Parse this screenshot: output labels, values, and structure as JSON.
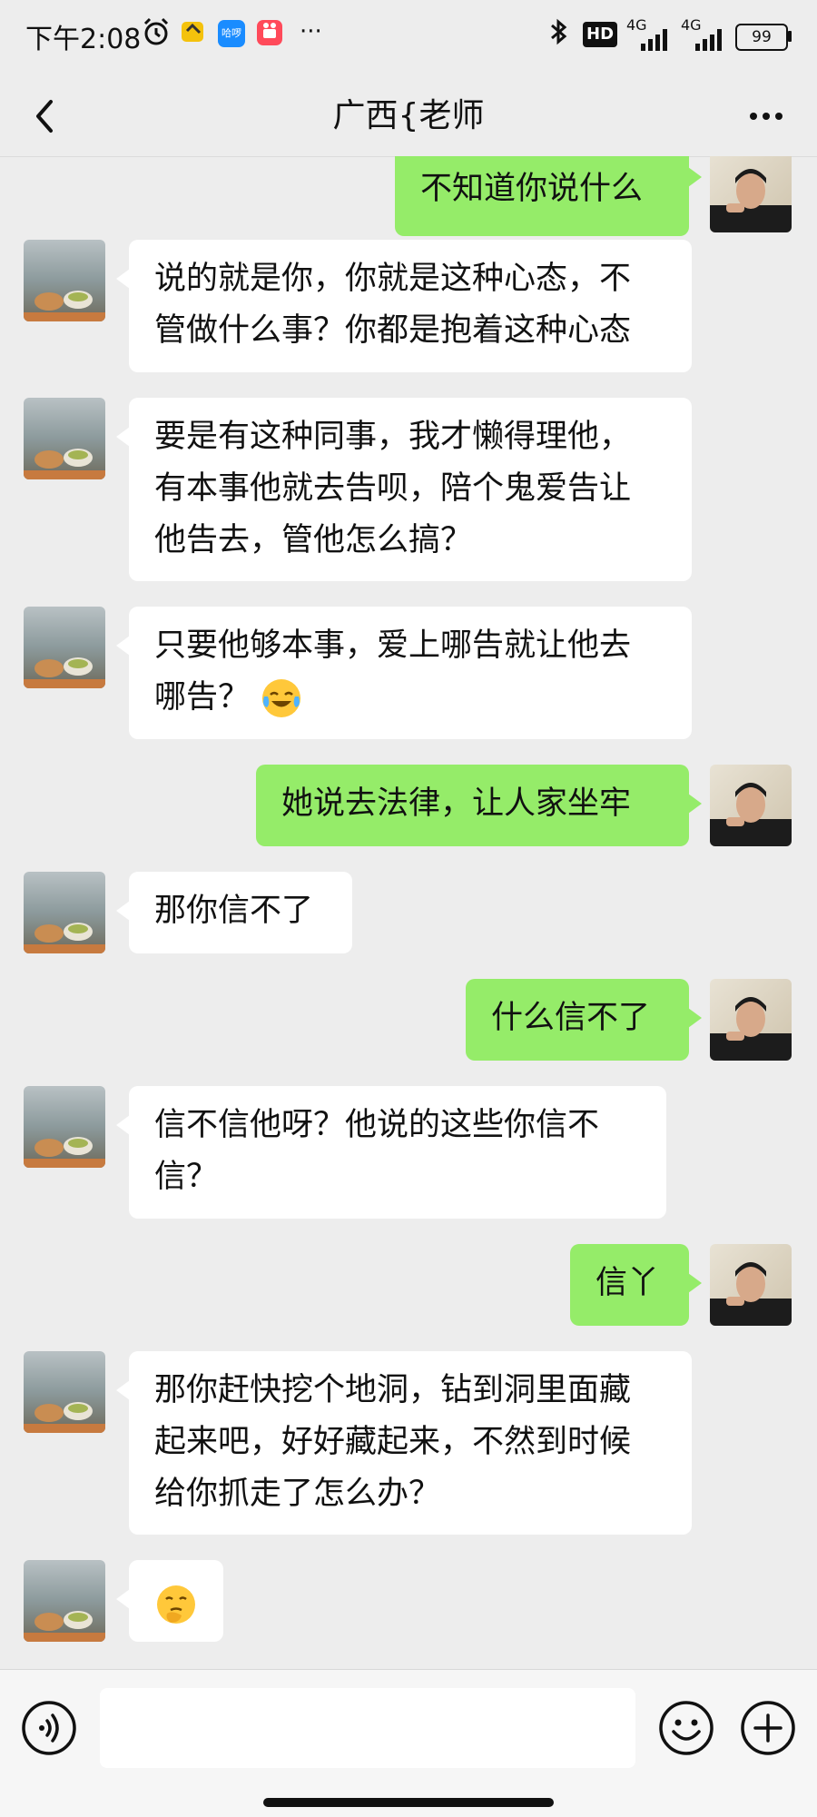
{
  "status_bar": {
    "time": "下午2:08",
    "network_1": "4G",
    "network_2": "4G",
    "hd_label": "HD",
    "battery": "99",
    "app_badge_text": "哈啰",
    "overflow": "···"
  },
  "nav": {
    "title": "广西{老师"
  },
  "messages": [
    {
      "side": "right",
      "text": "不知道你说什么"
    },
    {
      "side": "left",
      "lines": [
        "说的就是你，你就是这种心态，不",
        "管做什么事？你都是抱着这种心态"
      ]
    },
    {
      "side": "left",
      "lines": [
        "要是有这种同事，我才懒得理他，",
        "有本事他就去告呗，陪个鬼爱告让",
        "他告去，管他怎么搞？"
      ]
    },
    {
      "side": "left",
      "lines": [
        "只要他够本事，爱上哪告就让他去",
        "哪告？"
      ],
      "emoji": "cry-laugh-emoji"
    },
    {
      "side": "right",
      "text": "她说去法律，让人家坐牢"
    },
    {
      "side": "left",
      "text": "那你信不了"
    },
    {
      "side": "right",
      "text": "什么信不了"
    },
    {
      "side": "left",
      "lines": [
        "信不信他呀？他说的这些你信不",
        "信？"
      ]
    },
    {
      "side": "right",
      "text": "信丫"
    },
    {
      "side": "left",
      "lines": [
        "那你赶快挖个地洞，钻到洞里面藏",
        "起来吧，好好藏起来，不然到时候",
        "给你抓走了怎么办？"
      ]
    },
    {
      "side": "left",
      "emoji_only": "thinking-emoji"
    }
  ],
  "input": {
    "value": "",
    "placeholder": ""
  },
  "colors": {
    "background": "#ededed",
    "self_bubble": "#95ec69",
    "other_bubble": "#ffffff"
  }
}
